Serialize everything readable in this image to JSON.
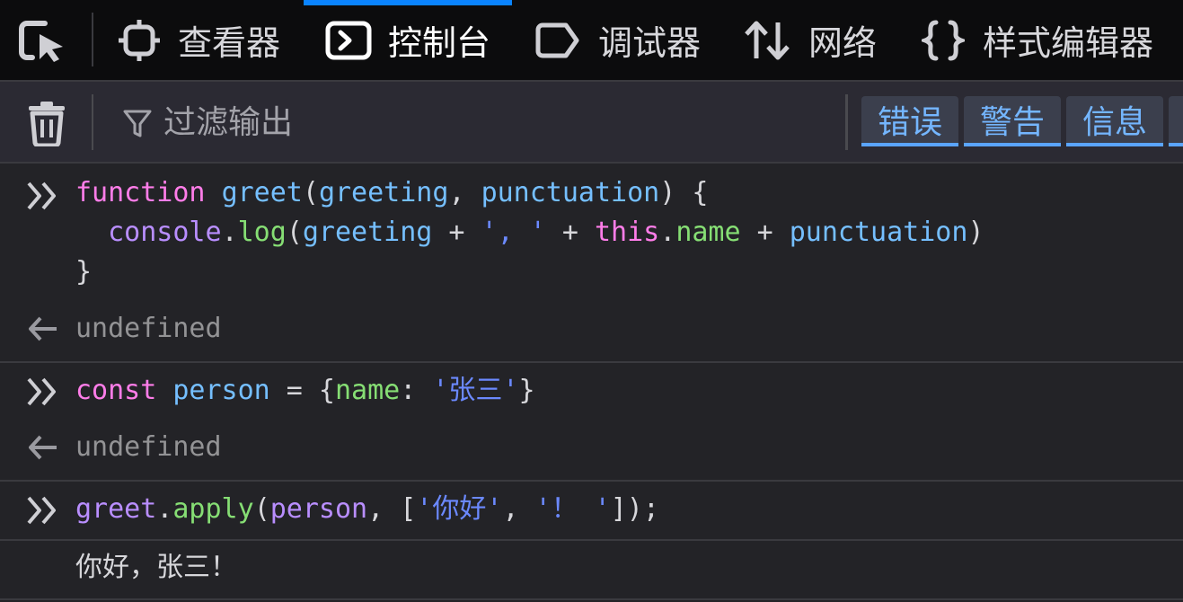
{
  "toolbar": {
    "tabs": [
      {
        "label": "查看器",
        "icon": "inspector-icon"
      },
      {
        "label": "控制台",
        "icon": "console-icon",
        "selected": true
      },
      {
        "label": "调试器",
        "icon": "debugger-icon"
      },
      {
        "label": "网络",
        "icon": "network-icon"
      },
      {
        "label": "样式编辑器",
        "icon": "style-editor-icon"
      }
    ]
  },
  "filterbar": {
    "placeholder": "过滤输出",
    "levels": [
      "错误",
      "警告",
      "信息"
    ]
  },
  "console": {
    "entries": [
      {
        "input_lines": [
          [
            [
              "k-pink",
              "function"
            ],
            [
              "k-plain",
              " "
            ],
            [
              "k-blue",
              "greet"
            ],
            [
              "k-plain",
              "("
            ],
            [
              "k-blue",
              "greeting"
            ],
            [
              "k-plain",
              ", "
            ],
            [
              "k-blue",
              "punctuation"
            ],
            [
              "k-plain",
              ") {"
            ]
          ],
          [
            [
              "k-plain",
              "  "
            ],
            [
              "k-purp",
              "console"
            ],
            [
              "k-plain",
              "."
            ],
            [
              "k-green",
              "log"
            ],
            [
              "k-plain",
              "("
            ],
            [
              "k-blue",
              "greeting"
            ],
            [
              "k-plain",
              " + "
            ],
            [
              "k-str",
              "', '"
            ],
            [
              "k-plain",
              " + "
            ],
            [
              "k-pink",
              "this"
            ],
            [
              "k-plain",
              "."
            ],
            [
              "k-green",
              "name"
            ],
            [
              "k-plain",
              " + "
            ],
            [
              "k-blue",
              "punctuation"
            ],
            [
              "k-plain",
              ")"
            ]
          ],
          [
            [
              "k-plain",
              "}"
            ]
          ]
        ],
        "result": "undefined"
      },
      {
        "input_lines": [
          [
            [
              "k-pink",
              "const"
            ],
            [
              "k-plain",
              " "
            ],
            [
              "k-blue",
              "person"
            ],
            [
              "k-plain",
              " = {"
            ],
            [
              "k-green",
              "name"
            ],
            [
              "k-plain",
              ": "
            ],
            [
              "k-str",
              "'张三'"
            ],
            [
              "k-plain",
              "}"
            ]
          ]
        ],
        "result": "undefined"
      },
      {
        "input_lines": [
          [
            [
              "k-purp",
              "greet"
            ],
            [
              "k-plain",
              "."
            ],
            [
              "k-green",
              "apply"
            ],
            [
              "k-plain",
              "("
            ],
            [
              "k-purp",
              "person"
            ],
            [
              "k-plain",
              ", ["
            ],
            [
              "k-str",
              "'你好'"
            ],
            [
              "k-plain",
              ", "
            ],
            [
              "k-str",
              "'！ '"
            ],
            [
              "k-plain",
              "]);"
            ]
          ]
        ],
        "output": "你好，张三！"
      }
    ]
  }
}
